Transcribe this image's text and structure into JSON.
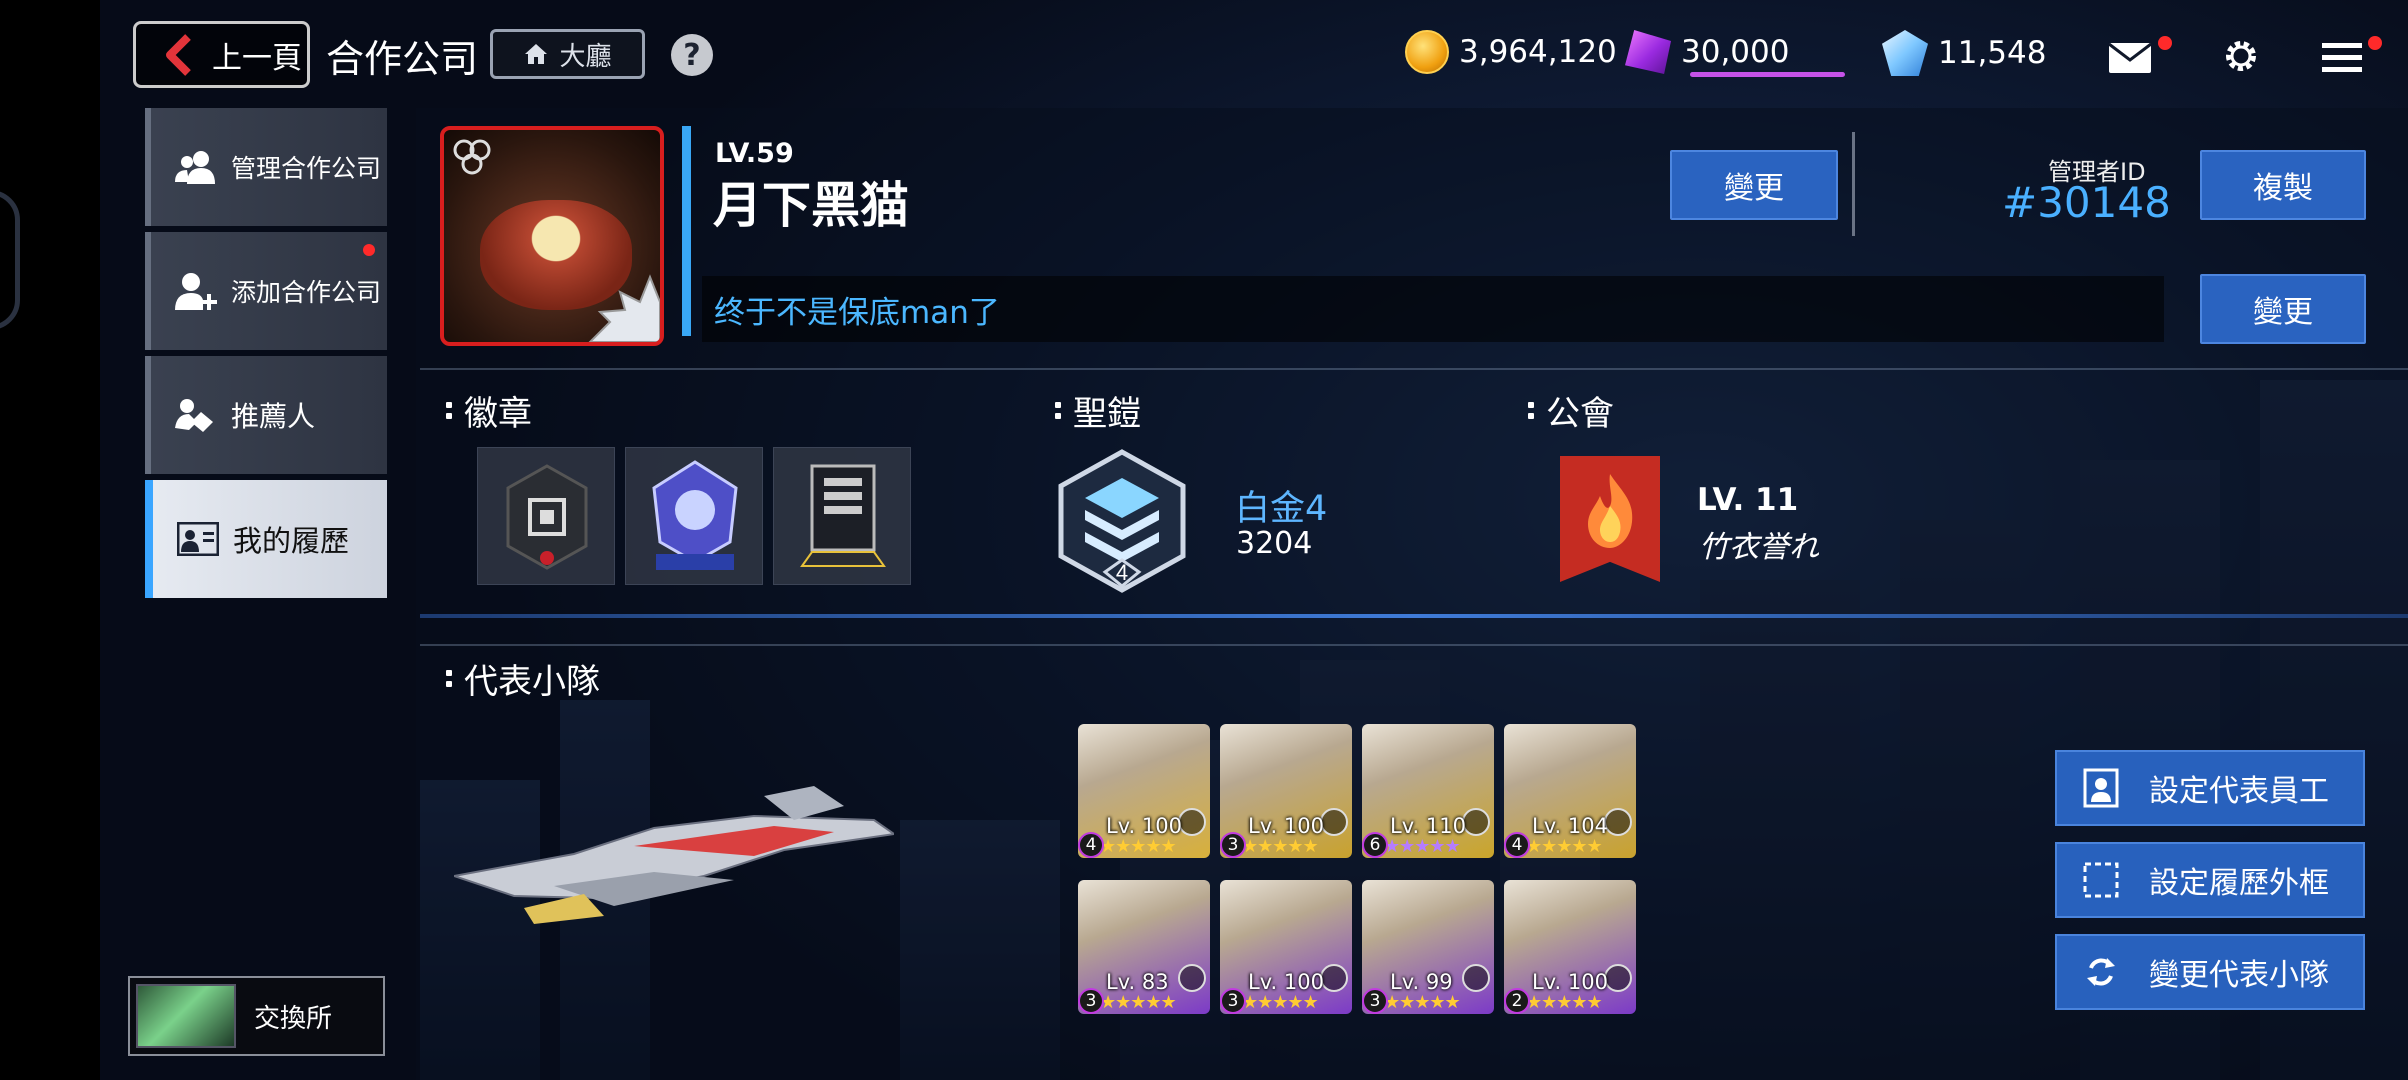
{
  "topbar": {
    "back_label": "上一頁",
    "title": "合作公司",
    "lobby_label": "大廳",
    "help_label": "?",
    "gold": "3,964,120",
    "gems": "30,000",
    "crystals": "11,548"
  },
  "sidebar": {
    "items": [
      {
        "label": "管理合作公司",
        "icon": "users-icon",
        "active": false
      },
      {
        "label": "添加合作公司",
        "icon": "add-user-icon",
        "active": false,
        "notice": true
      },
      {
        "label": "推薦人",
        "icon": "handshake-icon",
        "active": false
      },
      {
        "label": "我的履歷",
        "icon": "profile-card-icon",
        "active": true
      }
    ],
    "exchange_label": "交換所"
  },
  "profile": {
    "level": "LV.59",
    "nickname": "月下黑猫",
    "change_label": "變更",
    "admin_id_label": "管理者ID",
    "admin_id": "#30148",
    "copy_label": "複製",
    "intro": "终于不是保底man了",
    "intro_change_label": "變更"
  },
  "badges": {
    "title": "徽章"
  },
  "armor": {
    "title": "聖鎧",
    "tier_number": "4",
    "rank_name": "白金4",
    "score": "3204"
  },
  "guild": {
    "title": "公會",
    "level": "LV. 11",
    "name": "竹衣誉れ"
  },
  "squad": {
    "title": "代表小隊",
    "members": [
      {
        "level": "Lv. 100",
        "rank": "4",
        "stars": "★★★★★",
        "color": "#d8b03a"
      },
      {
        "level": "Lv. 100",
        "rank": "3",
        "stars": "★★★★★",
        "color": "#c9a22d"
      },
      {
        "level": "Lv. 110",
        "rank": "6",
        "stars": "★★★★★",
        "color": "#caa52a"
      },
      {
        "level": "Lv. 104",
        "rank": "4",
        "stars": "★★★★★",
        "color": "#c9a22d"
      },
      {
        "level": "Lv. 83",
        "rank": "3",
        "stars": "★★★★★",
        "color": "#7c3ac8"
      },
      {
        "level": "Lv. 100",
        "rank": "3",
        "stars": "★★★★★",
        "color": "#7c3ac8"
      },
      {
        "level": "Lv. 99",
        "rank": "3",
        "stars": "★★★★★",
        "color": "#7c3ac8"
      },
      {
        "level": "Lv. 100",
        "rank": "2",
        "stars": "★★★★★",
        "color": "#7c3ac8"
      }
    ]
  },
  "actions": {
    "set_rep_employee": "設定代表員工",
    "set_frame": "設定履歷外框",
    "change_squad": "變更代表小隊"
  }
}
